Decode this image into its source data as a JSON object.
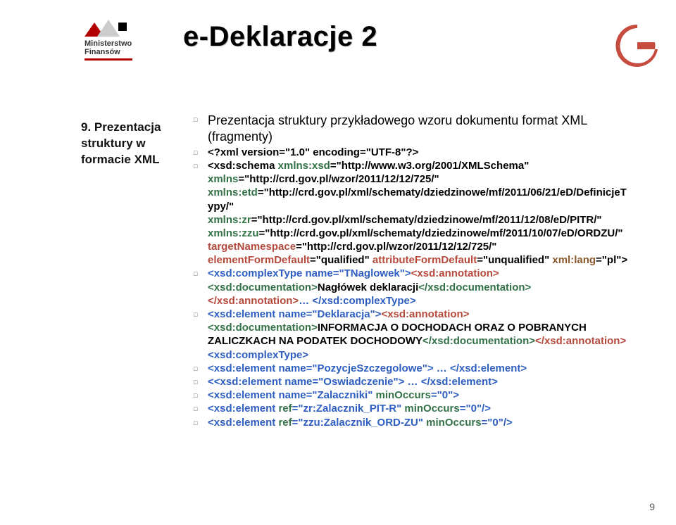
{
  "logo": {
    "line1": "Ministerstwo",
    "line2": "Finansów"
  },
  "title": "e-Deklaracje 2",
  "sidebar": "9. Prezentacja struktury w formacie XML",
  "items": [
    {
      "frags": [
        {
          "t": "Prezentacja struktury przykładowego wzoru dokumentu format XML (fragmenty)",
          "cls": "intro c-black"
        }
      ]
    },
    {
      "frags": [
        {
          "t": "<?xml version=\"1.0\" encoding=\"UTF-8\"?>",
          "cls": "bold c-black"
        }
      ]
    },
    {
      "frags": [
        {
          "t": "<xsd:schema ",
          "cls": "bold c-black"
        },
        {
          "t": "xmlns:xsd",
          "cls": "bold c-green"
        },
        {
          "t": "=\"http://www.w3.org/2001/XMLSchema\" ",
          "cls": "bold c-black"
        },
        {
          "t": "xmlns",
          "cls": "bold c-green"
        },
        {
          "t": "=\"http://crd.gov.pl/wzor/2011/12/12/725/\" ",
          "cls": "bold c-black"
        },
        {
          "t": "xmlns:etd",
          "cls": "bold c-green"
        },
        {
          "t": "=\"http://crd.gov.pl/xml/schematy/dziedzinowe/mf/2011/06/21/eD/DefinicjeTypy/\" ",
          "cls": "bold c-black"
        },
        {
          "t": "xmlns:zr",
          "cls": "bold c-green"
        },
        {
          "t": "=\"http://crd.gov.pl/xml/schematy/dziedzinowe/mf/2011/12/08/eD/PITR/\" ",
          "cls": "bold c-black"
        },
        {
          "t": "xmlns:zzu",
          "cls": "bold c-green"
        },
        {
          "t": "=\"http://crd.gov.pl/xml/schematy/dziedzinowe/mf/2011/10/07/eD/ORDZU/\" ",
          "cls": "bold c-black"
        },
        {
          "t": "targetNamespace",
          "cls": "bold c-red"
        },
        {
          "t": "=\"http://crd.gov.pl/wzor/2011/12/12/725/\" ",
          "cls": "bold c-black"
        },
        {
          "t": "elementFormDefault",
          "cls": "bold c-red"
        },
        {
          "t": "=\"qualified\" ",
          "cls": "bold c-black"
        },
        {
          "t": "attributeFormDefault",
          "cls": "bold c-red"
        },
        {
          "t": "=\"unqualified\" ",
          "cls": "bold c-black"
        },
        {
          "t": "xml:lang",
          "cls": "bold c-brown"
        },
        {
          "t": "=\"pl\">",
          "cls": "bold c-black"
        }
      ]
    },
    {
      "frags": [
        {
          "t": "<xsd:complexType name=\"TNaglowek\">",
          "cls": "bold c-blue"
        },
        {
          "t": "<xsd:annotation>",
          "cls": "bold c-red"
        },
        {
          "t": "<xsd:documentation>",
          "cls": "bold c-green"
        },
        {
          "t": "Nagłówek deklaracji",
          "cls": "bold c-black"
        },
        {
          "t": "</xsd:documentation>",
          "cls": "bold c-green"
        },
        {
          "t": "</xsd:annotation>",
          "cls": "bold c-red"
        },
        {
          "t": "… </xsd:complexType>",
          "cls": "bold c-blue"
        }
      ]
    },
    {
      "frags": [
        {
          "t": "<xsd:element name=\"Deklaracja\">",
          "cls": "bold c-blue"
        },
        {
          "t": "<xsd:annotation>",
          "cls": "bold c-red"
        },
        {
          "t": "<xsd:documentation>",
          "cls": "bold c-green"
        },
        {
          "t": "INFORMACJA O DOCHODACH ORAZ O POBRANYCH ZALICZKACH NA PODATEK DOCHODOWY",
          "cls": "bold c-black"
        },
        {
          "t": "</xsd:documentation>",
          "cls": "bold c-green"
        },
        {
          "t": "</xsd:annotation>",
          "cls": "bold c-red"
        },
        {
          "t": "<xsd:complexType>",
          "cls": "bold c-blue"
        }
      ]
    },
    {
      "frags": [
        {
          "t": "<xsd:element name=\"PozycjeSzczegolowe\"> … </xsd:element>",
          "cls": "bold c-blue"
        }
      ]
    },
    {
      "frags": [
        {
          "t": "<<xsd:element name=\"Oswiadczenie\"> … </xsd:element>",
          "cls": "bold c-blue"
        }
      ]
    },
    {
      "frags": [
        {
          "t": "<xsd:element name=\"Zalaczniki\" ",
          "cls": "bold c-blue"
        },
        {
          "t": "minOccurs",
          "cls": "bold c-green"
        },
        {
          "t": "=\"0\">",
          "cls": "bold c-blue"
        }
      ]
    },
    {
      "frags": [
        {
          "t": "<xsd:element ",
          "cls": "bold c-blue"
        },
        {
          "t": "ref",
          "cls": "bold c-green"
        },
        {
          "t": "=\"zr:Zalacznik_PIT-R\" ",
          "cls": "bold c-blue"
        },
        {
          "t": "minOccurs",
          "cls": "bold c-green"
        },
        {
          "t": "=\"0\"/>",
          "cls": "bold c-blue"
        }
      ]
    },
    {
      "frags": [
        {
          "t": "<xsd:element ",
          "cls": "bold c-blue"
        },
        {
          "t": "ref",
          "cls": "bold c-green"
        },
        {
          "t": "=\"zzu:Zalacznik_ORD-ZU\" ",
          "cls": "bold c-blue"
        },
        {
          "t": "minOccurs",
          "cls": "bold c-green"
        },
        {
          "t": "=\"0\"/>",
          "cls": "bold c-blue"
        }
      ]
    }
  ],
  "pagenum": "9"
}
